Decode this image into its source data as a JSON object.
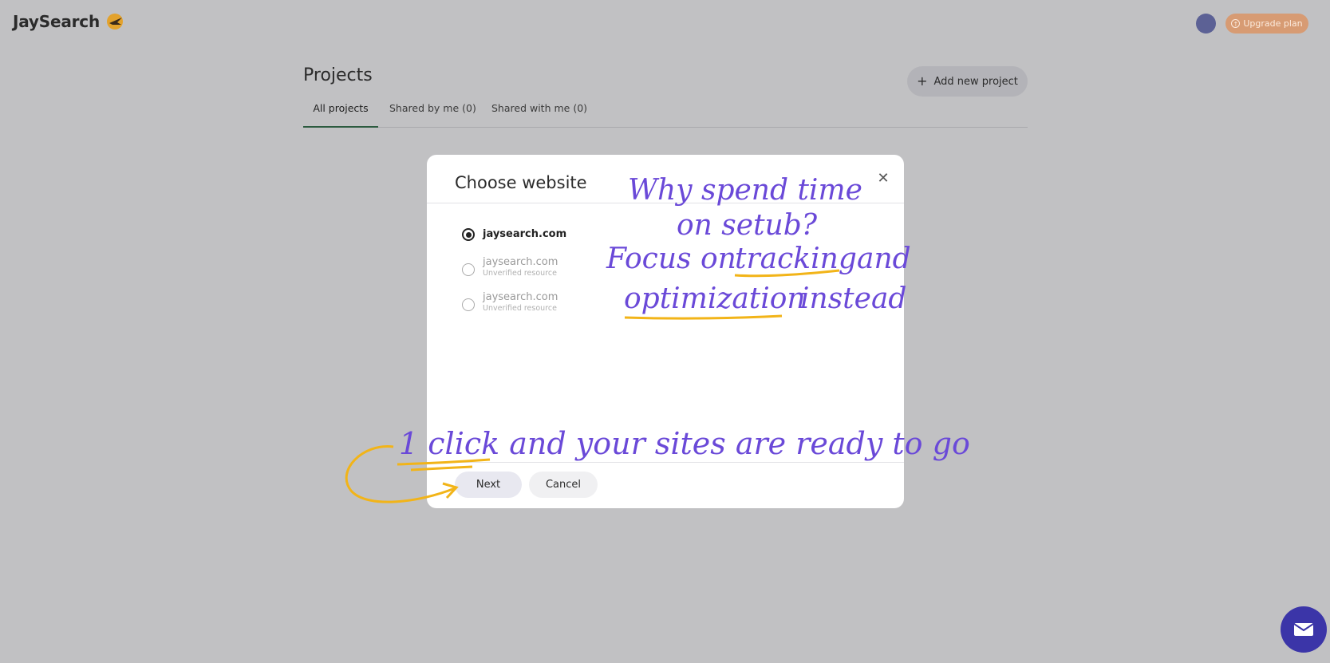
{
  "app": {
    "name": "JaySearch",
    "logo_icon": "bird-logo-icon"
  },
  "header": {
    "upgrade_label": "Upgrade plan",
    "upgrade_icon": "upgrade-icon"
  },
  "main": {
    "title": "Projects",
    "add_label": "Add new project",
    "tabs": [
      {
        "label": "All projects",
        "active": true
      },
      {
        "label": "Shared by me (0)"
      },
      {
        "label": "Shared with me (0)"
      }
    ]
  },
  "modal": {
    "title": "Choose website",
    "options": [
      {
        "name": "jaysearch.com",
        "selected": true
      },
      {
        "name": "jaysearch.com",
        "sub": "Unverified resource"
      },
      {
        "name": "jaysearch.com",
        "sub": "Unverified resource"
      }
    ],
    "next_label": "Next",
    "cancel_label": "Cancel"
  },
  "annotations": {
    "line1": "Why spend time",
    "line2": "on setub?",
    "line3a": "Focus on",
    "line3b": "tracking",
    "line3c": "and",
    "line4a": "optimization",
    "line4b": "instead",
    "bottom": "1 click and your sites are ready to go",
    "ink_color": "#6a49d8",
    "highlight_color": "#f2b418"
  },
  "colors": {
    "background": "#c1c1c3",
    "accent": "#2c5b3f",
    "upgrade": "#d79b73",
    "fab": "#3b35a8"
  }
}
